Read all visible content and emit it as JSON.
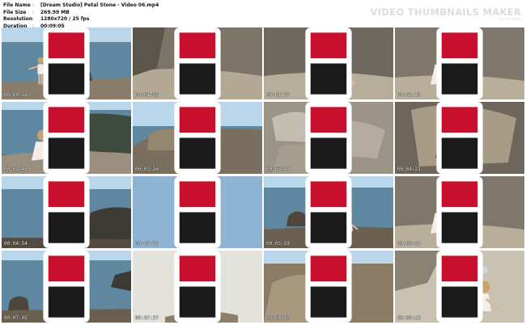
{
  "file_info": [
    {
      "key": "File Name",
      "value": "[Dream Studio] Petal Stone - Video 06.mp4"
    },
    {
      "key": "File Size",
      "value": "269.99 MB"
    },
    {
      "key": "Resolution",
      "value": "1280x720 / 25 fps"
    },
    {
      "key": "Duration",
      "value": "00:09:05"
    }
  ],
  "separator": ":",
  "brand": {
    "title": "VIDEO THUMBNAILS MAKER",
    "subtitle": "by ahmeds"
  },
  "thumbnails": [
    {
      "time": "00:00:32",
      "scene": "sea-figure"
    },
    {
      "time": "00:01:05",
      "scene": "rock-crouch"
    },
    {
      "time": "00:01:37",
      "scene": "rock-crouch-close"
    },
    {
      "time": "00:02:10",
      "scene": "rock-sit"
    },
    {
      "time": "00:02:43",
      "scene": "sea-sit"
    },
    {
      "time": "00:03:16",
      "scene": "rocks-coast"
    },
    {
      "time": "00:03:48",
      "scene": "stones"
    },
    {
      "time": "00:04:21",
      "scene": "boulder"
    },
    {
      "time": "00:04:54",
      "scene": "sea-arms"
    },
    {
      "time": "00:05:26",
      "scene": "sky-portrait"
    },
    {
      "time": "00:05:59",
      "scene": "sea-crouch"
    },
    {
      "time": "00:06:32",
      "scene": "rock-sit"
    },
    {
      "time": "00:07:05",
      "scene": "sea-walk"
    },
    {
      "time": "00:07:37",
      "scene": "sky-dance"
    },
    {
      "time": "00:08:10",
      "scene": "rock-stand"
    },
    {
      "time": "00:08:43",
      "scene": "rock-hat-crouch"
    }
  ],
  "colors": {
    "sky": "#b9d6ea",
    "sea": "#5f87a0",
    "rock": "#8a7d6b",
    "rock_dark": "#4e463c",
    "figure": "#f2ede6",
    "hair": "#c9a36a",
    "logo": "#c8102e"
  }
}
